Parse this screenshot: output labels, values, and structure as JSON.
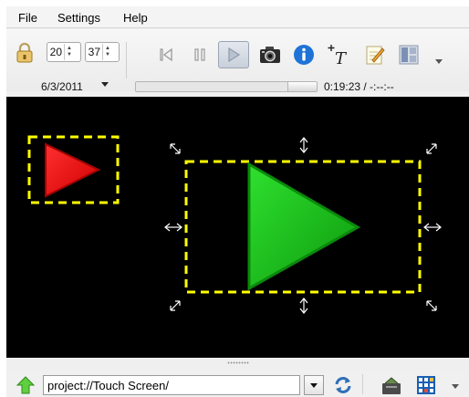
{
  "menu": {
    "file": "File",
    "settings": "Settings",
    "help": "Help"
  },
  "toolbar": {
    "spin_a_value": "20",
    "spin_b_value": "37",
    "date": "6/3/2011",
    "time_display": "0:19:23 / -:--:--",
    "icons": [
      "lock-icon",
      "skip-back-icon",
      "pause-icon",
      "play-icon",
      "camera-icon",
      "info-icon",
      "add-text-icon",
      "edit-icon",
      "layout-icon"
    ]
  },
  "canvas": {
    "background": "#000000",
    "selection_color": "#ffff00",
    "small_triangle_color": "#ff0000",
    "large_triangle_color": "#00c000"
  },
  "statusbar": {
    "path_value": "project://Touch Screen/",
    "icons": [
      "up-arrow-icon",
      "refresh-icon",
      "tools-icon",
      "grid-icon"
    ]
  }
}
